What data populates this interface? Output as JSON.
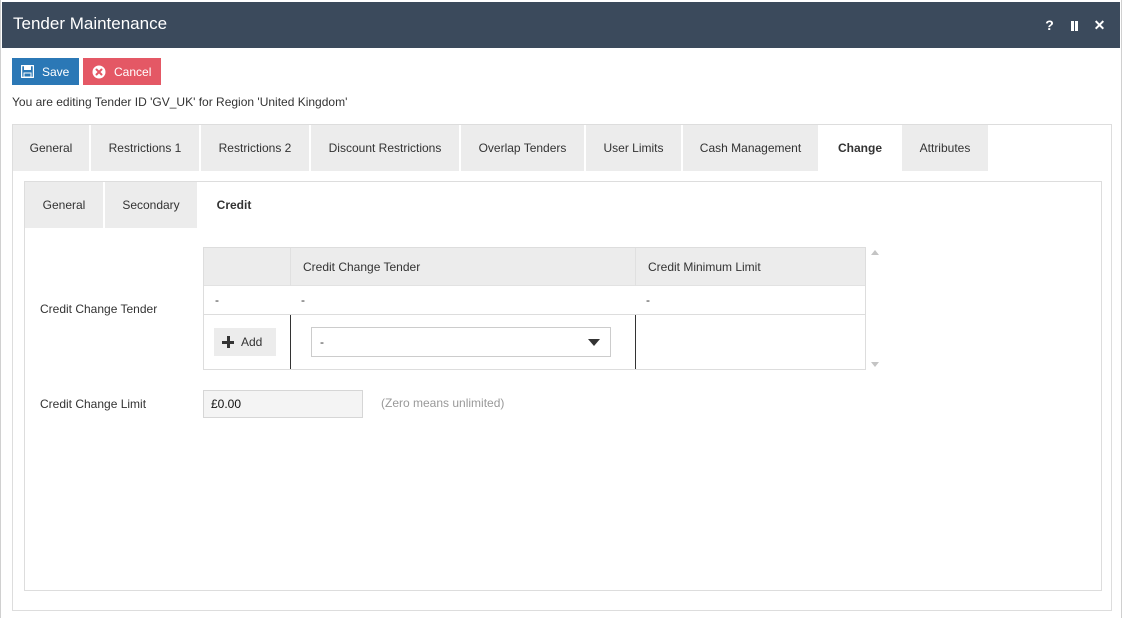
{
  "window": {
    "title": "Tender Maintenance",
    "controls": {
      "help": "?",
      "close": "✕"
    }
  },
  "toolbar": {
    "save_label": "Save",
    "cancel_label": "Cancel"
  },
  "editing_message": "You are editing Tender ID 'GV_UK' for Region 'United Kingdom'",
  "main_tabs": [
    {
      "label": "General"
    },
    {
      "label": "Restrictions 1"
    },
    {
      "label": "Restrictions 2"
    },
    {
      "label": "Discount Restrictions"
    },
    {
      "label": "Overlap Tenders"
    },
    {
      "label": "User Limits"
    },
    {
      "label": "Cash Management"
    },
    {
      "label": "Change",
      "active": true
    },
    {
      "label": "Attributes"
    }
  ],
  "sub_tabs": [
    {
      "label": "General"
    },
    {
      "label": "Secondary"
    },
    {
      "label": "Credit",
      "active": true
    }
  ],
  "credit": {
    "credit_change_tender_label": "Credit Change Tender",
    "grid": {
      "columns": [
        "",
        "Credit Change Tender",
        "Credit Minimum Limit"
      ],
      "rows": [
        [
          "-",
          "-",
          "-"
        ]
      ],
      "add_label": "Add",
      "new_row_select_value": "-"
    },
    "credit_change_limit_label": "Credit Change Limit",
    "credit_change_limit_value": "£0.00",
    "hint": "(Zero means unlimited)"
  },
  "colors": {
    "titlebar": "#3b4a5c",
    "save": "#2b78b6",
    "cancel": "#e45865",
    "tab_inactive": "#ececec"
  },
  "icons": [
    "floppy-disk-icon",
    "cancel-circle-icon",
    "help-icon",
    "pause-icon",
    "close-icon",
    "plus-icon",
    "chevron-down-icon"
  ]
}
